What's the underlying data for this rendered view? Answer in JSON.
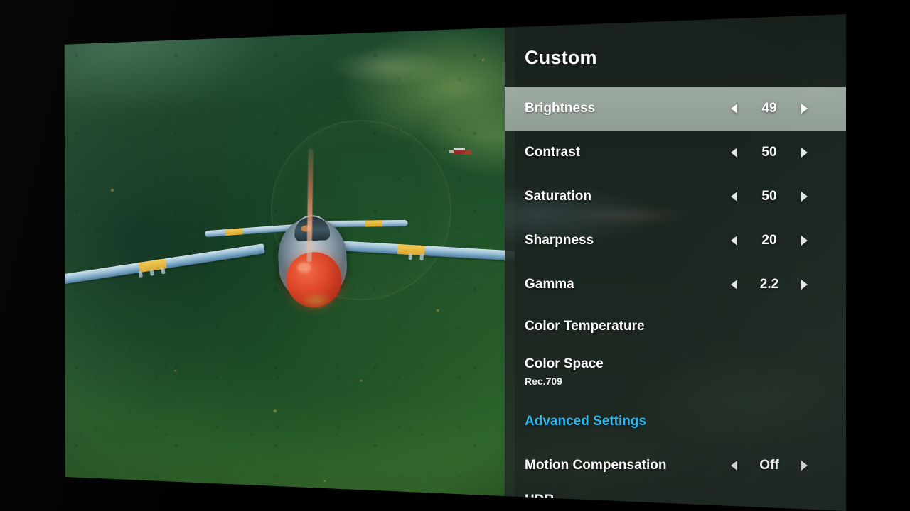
{
  "screen": {
    "title": "Custom",
    "device_context": "tv-picture-settings-menu"
  },
  "settings": {
    "rows": [
      {
        "label": "Brightness",
        "value": "49",
        "type": "stepper",
        "highlighted": true,
        "sub": ""
      },
      {
        "label": "Contrast",
        "value": "50",
        "type": "stepper",
        "highlighted": false,
        "sub": ""
      },
      {
        "label": "Saturation",
        "value": "50",
        "type": "stepper",
        "highlighted": false,
        "sub": ""
      },
      {
        "label": "Sharpness",
        "value": "20",
        "type": "stepper",
        "highlighted": false,
        "sub": ""
      },
      {
        "label": "Gamma",
        "value": "2.2",
        "type": "stepper",
        "highlighted": false,
        "sub": ""
      },
      {
        "label": "Color Temperature",
        "value": "",
        "type": "plain",
        "highlighted": false,
        "sub": ""
      },
      {
        "label": "Color Space",
        "value": "",
        "type": "plain",
        "highlighted": false,
        "sub": "Rec.709"
      },
      {
        "label": "Advanced Settings",
        "value": "",
        "type": "link",
        "highlighted": false,
        "sub": ""
      },
      {
        "label": "Motion Compensation",
        "value": "Off",
        "type": "stepper",
        "highlighted": false,
        "sub": ""
      }
    ],
    "cut_off_row_label": "HDR"
  },
  "icons": {
    "decrement": "caret-left-icon",
    "increment": "caret-right-icon"
  },
  "colors": {
    "panel_background": "#1f2722",
    "highlight_row": "#9aa89e",
    "link_accent": "#2bb8f0",
    "label_text": "#ffffff",
    "bezel": "#000000"
  },
  "video": {
    "description": "propeller-aircraft-over-forest",
    "aircraft_colors": {
      "nose": "#d8492a",
      "wings": "#8fb6d0",
      "stripes": "#e8b93f"
    }
  }
}
